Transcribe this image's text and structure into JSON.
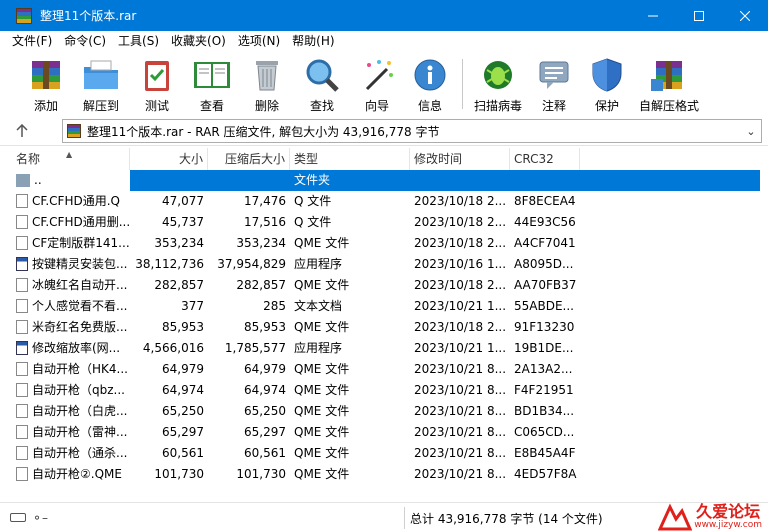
{
  "window": {
    "title": "整理11个版本.rar",
    "minimize_icon": "minimize-icon",
    "maximize_icon": "maximize-icon",
    "close_icon": "close-icon"
  },
  "menu": [
    {
      "label": "文件(F)"
    },
    {
      "label": "命令(C)"
    },
    {
      "label": "工具(S)"
    },
    {
      "label": "收藏夹(O)"
    },
    {
      "label": "选项(N)"
    },
    {
      "label": "帮助(H)"
    }
  ],
  "toolbar": [
    {
      "label": "添加",
      "icon": "add-archive-icon"
    },
    {
      "label": "解压到",
      "icon": "extract-folder-icon"
    },
    {
      "label": "测试",
      "icon": "test-clipboard-icon"
    },
    {
      "label": "查看",
      "icon": "view-book-icon"
    },
    {
      "label": "删除",
      "icon": "trash-icon"
    },
    {
      "label": "查找",
      "icon": "find-magnifier-icon"
    },
    {
      "label": "向导",
      "icon": "wizard-wand-icon"
    },
    {
      "label": "信息",
      "icon": "info-icon"
    },
    {
      "label": "扫描病毒",
      "icon": "virus-scan-icon"
    },
    {
      "label": "注释",
      "icon": "comment-icon"
    },
    {
      "label": "保护",
      "icon": "shield-icon"
    },
    {
      "label": "自解压格式",
      "icon": "sfx-archive-icon"
    }
  ],
  "address": {
    "text": "整理11个版本.rar - RAR 压缩文件, 解包大小为 43,916,778 字节"
  },
  "columns": {
    "name": "名称",
    "size": "大小",
    "packed": "压缩后大小",
    "type": "类型",
    "modified": "修改时间",
    "crc": "CRC32"
  },
  "rows": [
    {
      "name": "..",
      "size": "",
      "packed": "",
      "type": "文件夹",
      "modified": "",
      "crc": "",
      "kind": "parent"
    },
    {
      "name": "CF.CFHD通用.Q",
      "size": "47,077",
      "packed": "17,476",
      "type": "Q 文件",
      "modified": "2023/10/18 2...",
      "crc": "8F8ECEA4",
      "kind": "file"
    },
    {
      "name": "CF.CFHD通用删...",
      "size": "45,737",
      "packed": "17,516",
      "type": "Q 文件",
      "modified": "2023/10/18 2...",
      "crc": "44E93C56",
      "kind": "file"
    },
    {
      "name": "CF定制版群141...",
      "size": "353,234",
      "packed": "353,234",
      "type": "QME 文件",
      "modified": "2023/10/18 2...",
      "crc": "A4CF7041",
      "kind": "file"
    },
    {
      "name": "按键精灵安装包...",
      "size": "38,112,736",
      "packed": "37,954,829",
      "type": "应用程序",
      "modified": "2023/10/16 1...",
      "crc": "A8095D...",
      "kind": "app"
    },
    {
      "name": "冰魄红名自动开...",
      "size": "282,857",
      "packed": "282,857",
      "type": "QME 文件",
      "modified": "2023/10/18 2...",
      "crc": "AA70FB37",
      "kind": "file"
    },
    {
      "name": "个人感觉看不看...",
      "size": "377",
      "packed": "285",
      "type": "文本文档",
      "modified": "2023/10/21 1...",
      "crc": "55ABDE...",
      "kind": "file"
    },
    {
      "name": "米奇红名免费版...",
      "size": "85,953",
      "packed": "85,953",
      "type": "QME 文件",
      "modified": "2023/10/18 2...",
      "crc": "91F13230",
      "kind": "file"
    },
    {
      "name": "修改缩放率(网...",
      "size": "4,566,016",
      "packed": "1,785,577",
      "type": "应用程序",
      "modified": "2023/10/21 1...",
      "crc": "19B1DE...",
      "kind": "app"
    },
    {
      "name": "自动开枪（HK4...",
      "size": "64,979",
      "packed": "64,979",
      "type": "QME 文件",
      "modified": "2023/10/21 8...",
      "crc": "2A13A2...",
      "kind": "file"
    },
    {
      "name": "自动开枪（qbz...",
      "size": "64,974",
      "packed": "64,974",
      "type": "QME 文件",
      "modified": "2023/10/21 8...",
      "crc": "F4F21951",
      "kind": "file"
    },
    {
      "name": "自动开枪（白虎...",
      "size": "65,250",
      "packed": "65,250",
      "type": "QME 文件",
      "modified": "2023/10/21 8...",
      "crc": "BD1B34...",
      "kind": "file"
    },
    {
      "name": "自动开枪（雷神...",
      "size": "65,297",
      "packed": "65,297",
      "type": "QME 文件",
      "modified": "2023/10/21 8...",
      "crc": "C065CD...",
      "kind": "file"
    },
    {
      "name": "自动开枪（通杀...",
      "size": "60,561",
      "packed": "60,561",
      "type": "QME 文件",
      "modified": "2023/10/21 8...",
      "crc": "E8B45A4F",
      "kind": "file"
    },
    {
      "name": "自动开枪②.QME",
      "size": "101,730",
      "packed": "101,730",
      "type": "QME 文件",
      "modified": "2023/10/21 8...",
      "crc": "4ED57F8A",
      "kind": "file"
    }
  ],
  "status": {
    "text": "总计 43,916,778 字节 (14 个文件)"
  },
  "watermark": {
    "main": "久爱论坛",
    "url": "www.jizyw.com"
  },
  "colors": {
    "titlebar": "#0078d7",
    "selection": "#0078d7",
    "watermark": "#e0201a"
  }
}
